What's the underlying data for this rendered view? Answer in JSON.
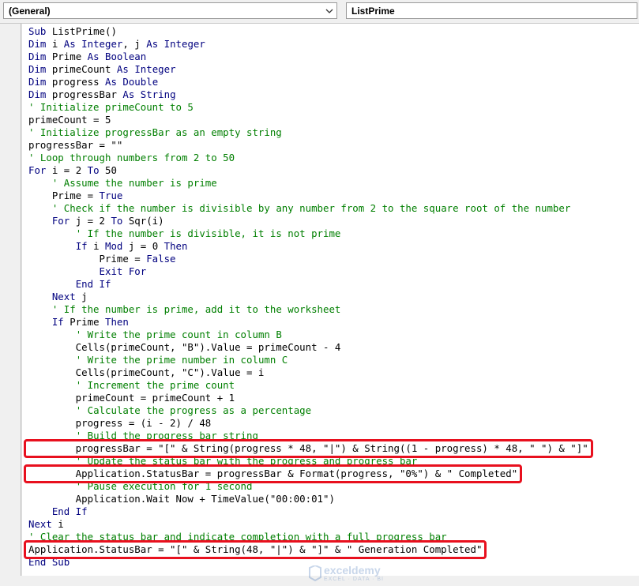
{
  "toolbar": {
    "object_combo": "(General)",
    "procedure_combo": "ListPrime"
  },
  "code": [
    [
      [
        "kw",
        "Sub"
      ],
      [
        "t",
        " ListPrime()"
      ]
    ],
    [
      [
        "kw",
        "Dim"
      ],
      [
        "t",
        " i "
      ],
      [
        "kw",
        "As"
      ],
      [
        "t",
        " "
      ],
      [
        "kw",
        "Integer"
      ],
      [
        "t",
        ", j "
      ],
      [
        "kw",
        "As"
      ],
      [
        "t",
        " "
      ],
      [
        "kw",
        "Integer"
      ]
    ],
    [
      [
        "kw",
        "Dim"
      ],
      [
        "t",
        " Prime "
      ],
      [
        "kw",
        "As"
      ],
      [
        "t",
        " "
      ],
      [
        "kw",
        "Boolean"
      ]
    ],
    [
      [
        "kw",
        "Dim"
      ],
      [
        "t",
        " primeCount "
      ],
      [
        "kw",
        "As"
      ],
      [
        "t",
        " "
      ],
      [
        "kw",
        "Integer"
      ]
    ],
    [
      [
        "kw",
        "Dim"
      ],
      [
        "t",
        " progress "
      ],
      [
        "kw",
        "As"
      ],
      [
        "t",
        " "
      ],
      [
        "kw",
        "Double"
      ]
    ],
    [
      [
        "kw",
        "Dim"
      ],
      [
        "t",
        " progressBar "
      ],
      [
        "kw",
        "As"
      ],
      [
        "t",
        " "
      ],
      [
        "kw",
        "String"
      ]
    ],
    [
      [
        "cm",
        "' Initialize primeCount to 5"
      ]
    ],
    [
      [
        "t",
        "primeCount = 5"
      ]
    ],
    [
      [
        "cm",
        "' Initialize progressBar as an empty string"
      ]
    ],
    [
      [
        "t",
        "progressBar = \"\""
      ]
    ],
    [
      [
        "cm",
        "' Loop through numbers from 2 to 50"
      ]
    ],
    [
      [
        "kw",
        "For"
      ],
      [
        "t",
        " i = 2 "
      ],
      [
        "kw",
        "To"
      ],
      [
        "t",
        " 50"
      ]
    ],
    [
      [
        "t",
        "    "
      ],
      [
        "cm",
        "' Assume the number is prime"
      ]
    ],
    [
      [
        "t",
        "    Prime = "
      ],
      [
        "kw",
        "True"
      ]
    ],
    [
      [
        "t",
        "    "
      ],
      [
        "cm",
        "' Check if the number is divisible by any number from 2 to the square root of the number"
      ]
    ],
    [
      [
        "t",
        "    "
      ],
      [
        "kw",
        "For"
      ],
      [
        "t",
        " j = 2 "
      ],
      [
        "kw",
        "To"
      ],
      [
        "t",
        " Sqr(i)"
      ]
    ],
    [
      [
        "t",
        "        "
      ],
      [
        "cm",
        "' If the number is divisible, it is not prime"
      ]
    ],
    [
      [
        "t",
        "        "
      ],
      [
        "kw",
        "If"
      ],
      [
        "t",
        " i "
      ],
      [
        "kw",
        "Mod"
      ],
      [
        "t",
        " j = 0 "
      ],
      [
        "kw",
        "Then"
      ]
    ],
    [
      [
        "t",
        "            Prime = "
      ],
      [
        "kw",
        "False"
      ]
    ],
    [
      [
        "t",
        "            "
      ],
      [
        "kw",
        "Exit For"
      ]
    ],
    [
      [
        "t",
        "        "
      ],
      [
        "kw",
        "End If"
      ]
    ],
    [
      [
        "t",
        "    "
      ],
      [
        "kw",
        "Next"
      ],
      [
        "t",
        " j"
      ]
    ],
    [
      [
        "t",
        "    "
      ],
      [
        "cm",
        "' If the number is prime, add it to the worksheet"
      ]
    ],
    [
      [
        "t",
        "    "
      ],
      [
        "kw",
        "If"
      ],
      [
        "t",
        " Prime "
      ],
      [
        "kw",
        "Then"
      ]
    ],
    [
      [
        "t",
        "        "
      ],
      [
        "cm",
        "' Write the prime count in column B"
      ]
    ],
    [
      [
        "t",
        "        Cells(primeCount, \"B\").Value = primeCount - 4"
      ]
    ],
    [
      [
        "t",
        "        "
      ],
      [
        "cm",
        "' Write the prime number in column C"
      ]
    ],
    [
      [
        "t",
        "        Cells(primeCount, \"C\").Value = i"
      ]
    ],
    [
      [
        "t",
        "        "
      ],
      [
        "cm",
        "' Increment the prime count"
      ]
    ],
    [
      [
        "t",
        "        primeCount = primeCount + 1"
      ]
    ],
    [
      [
        "t",
        "        "
      ],
      [
        "cm",
        "' Calculate the progress as a percentage"
      ]
    ],
    [
      [
        "t",
        "        progress = (i - 2) / 48"
      ]
    ],
    [
      [
        "t",
        "        "
      ],
      [
        "cm",
        "' Build the progress bar string"
      ]
    ],
    [
      [
        "t",
        "        progressBar = \"[\" & String(progress * 48, \"|\") & String((1 - progress) * 48, \" \") & \"]\""
      ]
    ],
    [
      [
        "t",
        "        "
      ],
      [
        "cm",
        "' Update the status bar with the progress and progress bar"
      ]
    ],
    [
      [
        "t",
        "        Application.StatusBar = progressBar & Format(progress, \"0%\") & \" Completed\""
      ]
    ],
    [
      [
        "t",
        "        "
      ],
      [
        "cm",
        "' Pause execution for 1 second"
      ]
    ],
    [
      [
        "t",
        "        Application.Wait Now + TimeValue(\"00:00:01\")"
      ]
    ],
    [
      [
        "t",
        "    "
      ],
      [
        "kw",
        "End If"
      ]
    ],
    [
      [
        "kw",
        "Next"
      ],
      [
        "t",
        " i"
      ]
    ],
    [
      [
        "cm",
        "' Clear the status bar and indicate completion with a full progress bar"
      ]
    ],
    [
      [
        "t",
        "Application.StatusBar = \"[\" & String(48, \"|\") & \"]\" & \" Generation Completed\""
      ]
    ],
    [
      [
        "kw",
        "End Sub"
      ]
    ]
  ],
  "highlights": [
    33,
    35,
    41
  ],
  "watermark": {
    "name": "exceldemy",
    "tagline": "EXCEL · DATA · BI"
  },
  "colors": {
    "keyword": "#00007f",
    "comment": "#007f00",
    "highlight_border": "#e8101e"
  }
}
